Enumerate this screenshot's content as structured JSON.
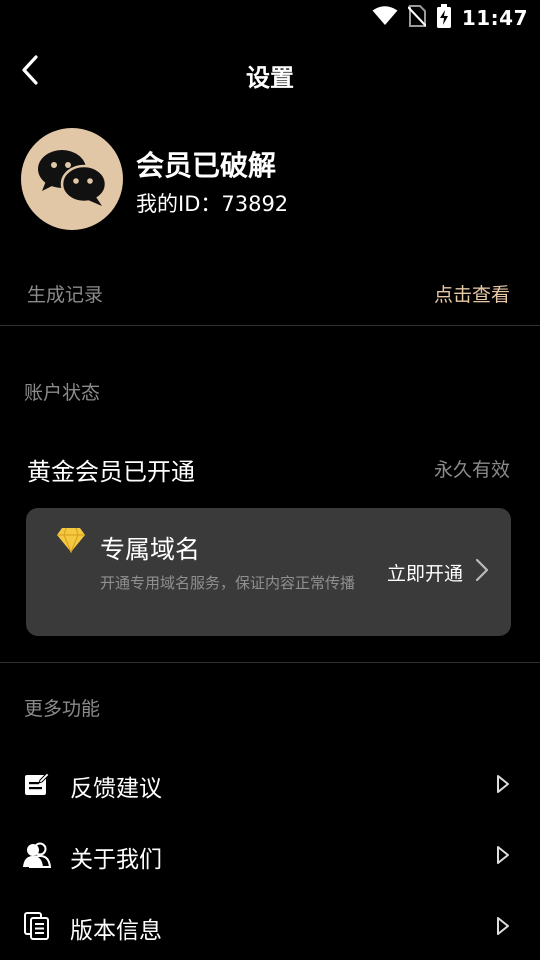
{
  "status_bar": {
    "time": "11:47",
    "icons": [
      "wifi-icon",
      "no-sim-icon",
      "battery-charging-icon"
    ]
  },
  "header": {
    "title": "设置",
    "back_icon": "chevron-left-icon"
  },
  "profile": {
    "name": "会员已破解",
    "id_text": "我的ID：73892",
    "avatar_icon": "chat-bubbles-icon",
    "avatar_color": "#e2c7a6"
  },
  "records": {
    "label": "生成记录",
    "link": "点击查看",
    "link_color": "#e8c9a6"
  },
  "account": {
    "section_label": "账户状态",
    "vip_title": "黄金会员已开通",
    "vip_status": "永久有效"
  },
  "domain_card": {
    "icon": "diamond-icon",
    "icon_color": "#f5c842",
    "title": "专属域名",
    "description": "开通专用域名服务，保证内容正常传播",
    "action": "立即开通"
  },
  "more": {
    "section_label": "更多功能",
    "items": [
      {
        "label": "反馈建议",
        "icon": "edit-note-icon"
      },
      {
        "label": "关于我们",
        "icon": "people-icon"
      },
      {
        "label": "版本信息",
        "icon": "copy-document-icon"
      }
    ]
  }
}
